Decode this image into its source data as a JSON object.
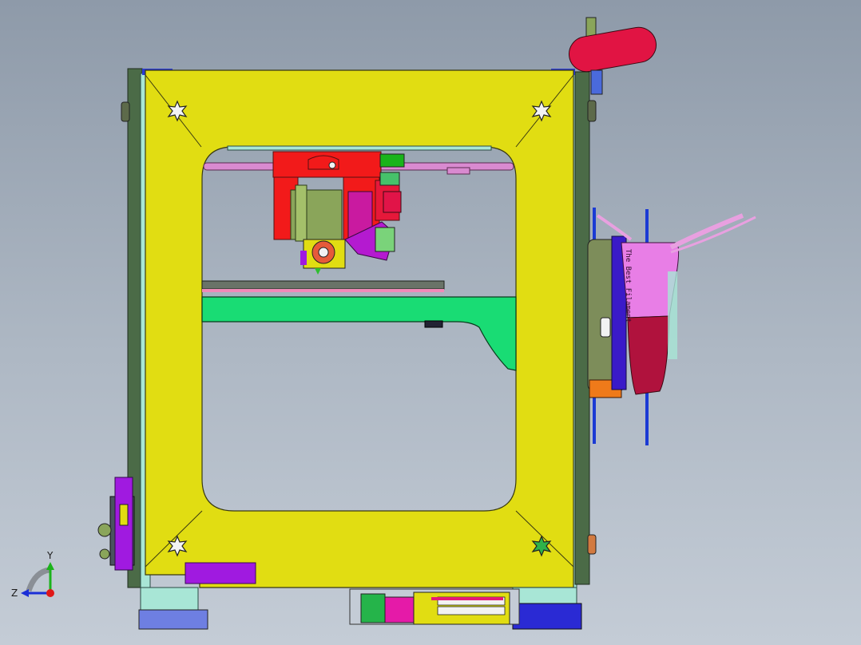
{
  "viewport": {
    "background_top": "#8e9aa9",
    "background_bottom": "#c4ccd6"
  },
  "model": {
    "colors": {
      "frame": "#e1dd12",
      "frame_outline": "#3a3a10",
      "side_plate": "#4b6b47",
      "rail_cyan": "#a8e6d6",
      "carriage_red": "#f21a1a",
      "motor_green": "#8aa55a",
      "rod_pink": "#d98ad0",
      "bed_green": "#19dc74",
      "bed_plate": "#6a7368",
      "purple_part": "#a01ae0",
      "spool_pink": "#e87ee6",
      "spool_crimson": "#b0123d",
      "fan_red": "#e11443",
      "foot_blue": "#2a2ad4",
      "orange_part": "#ef7a1a"
    },
    "spool_label": "The Best Filament",
    "icons": [
      "star-mount-icon",
      "fan-icon",
      "spool-icon",
      "axis-triad-icon"
    ]
  },
  "triad": {
    "y_label": "Y",
    "z_label": "Z",
    "y_color": "#1bb31b",
    "z_color": "#1b2fd6",
    "origin_color": "#e01818"
  }
}
